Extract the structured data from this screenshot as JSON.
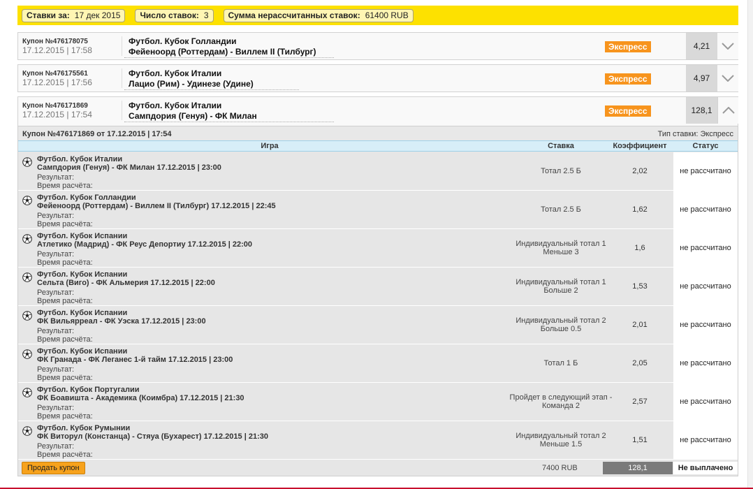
{
  "summary": {
    "bets_for_label": "Ставки за:",
    "bets_for_value": "17 дек 2015",
    "count_label": "Число ставок:",
    "count_value": "3",
    "unsettled_label": "Сумма нерассчитанных ставок:",
    "unsettled_value": "61400 RUB"
  },
  "coupons": [
    {
      "number": "Купон №476178075",
      "datetime": "17.12.2015 | 17:58",
      "tournament": "Футбол. Кубок Голландии",
      "match": "Фейеноорд (Роттердам) - Виллем II (Тилбург)",
      "type": "Экспресс",
      "odds": "4,21"
    },
    {
      "number": "Купон №476175561",
      "datetime": "17.12.2015 | 17:56",
      "tournament": "Футбол. Кубок Италии",
      "match": "Лацио (Рим) - Удинезе (Удине)",
      "type": "Экспресс",
      "odds": "4,97"
    },
    {
      "number": "Купон №476171869",
      "datetime": "17.12.2015 | 17:54",
      "tournament": "Футбол. Кубок Италии",
      "match": "Сампдория (Генуя) - ФК Милан",
      "type": "Экспресс",
      "odds": "128,1"
    }
  ],
  "details": {
    "title": "Купон №476171869 от 17.12.2015 | 17:54",
    "bet_type": "Тип ставки: Экспресс",
    "columns": {
      "game": "Игра",
      "bet": "Ставка",
      "coef": "Коэффициент",
      "status": "Статус"
    },
    "result_label": "Результат:",
    "calc_time_label": "Время расчёта:",
    "rows": [
      {
        "tournament": "Футбол. Кубок Италии",
        "match": "Сампдория (Генуя) - ФК Милан 17.12.2015 | 23:00",
        "bet": "Тотал 2.5 Б",
        "coef": "2,02",
        "status": "не рассчитано"
      },
      {
        "tournament": "Футбол. Кубок Голландии",
        "match": "Фейеноорд (Роттердам) - Виллем II (Тилбург) 17.12.2015 | 22:45",
        "bet": "Тотал 2.5 Б",
        "coef": "1,62",
        "status": "не рассчитано"
      },
      {
        "tournament": "Футбол. Кубок Испании",
        "match": "Атлетико (Мадрид) - ФК Реус Депортиу 17.12.2015 | 22:00",
        "bet": "Индивидуальный тотал 1 Меньше 3",
        "coef": "1,6",
        "status": "не рассчитано"
      },
      {
        "tournament": "Футбол. Кубок Испании",
        "match": "Сельта (Виго) - ФК Альмерия 17.12.2015 | 22:00",
        "bet": "Индивидуальный тотал 1 Больше 2",
        "coef": "1,53",
        "status": "не рассчитано"
      },
      {
        "tournament": "Футбол. Кубок Испании",
        "match": "ФК Вильярреал - ФК Уэска 17.12.2015 | 23:00",
        "bet": "Индивидуальный тотал 2 Больше 0.5",
        "coef": "2,01",
        "status": "не рассчитано"
      },
      {
        "tournament": "Футбол. Кубок Испании",
        "match": "ФК Гранада - ФК Леганес 1-й тайм 17.12.2015 | 23:00",
        "bet": "Тотал 1 Б",
        "coef": "2,05",
        "status": "не рассчитано"
      },
      {
        "tournament": "Футбол. Кубок Португалии",
        "match": "ФК Боавишта - Академика (Коимбра) 17.12.2015 | 21:30",
        "bet": "Пройдет в следующий этап - Команда 2",
        "coef": "2,57",
        "status": "не рассчитано"
      },
      {
        "tournament": "Футбол. Кубок Румынии",
        "match": "ФК Виторул (Констанца) - Стяуа (Бухарест) 17.12.2015 | 21:30",
        "bet": "Индивидуальный тотал 2 Меньше 1.5",
        "coef": "1,51",
        "status": "не рассчитано"
      }
    ],
    "footer": {
      "sell_label": "Продать купон",
      "amount": "7400 RUB",
      "total_coef": "128,1",
      "payout_status": "Не выплачено"
    }
  },
  "colors": {
    "accent_yellow": "#fde100",
    "badge_orange": "#f7941d",
    "header_blue": "#d7eef8"
  }
}
